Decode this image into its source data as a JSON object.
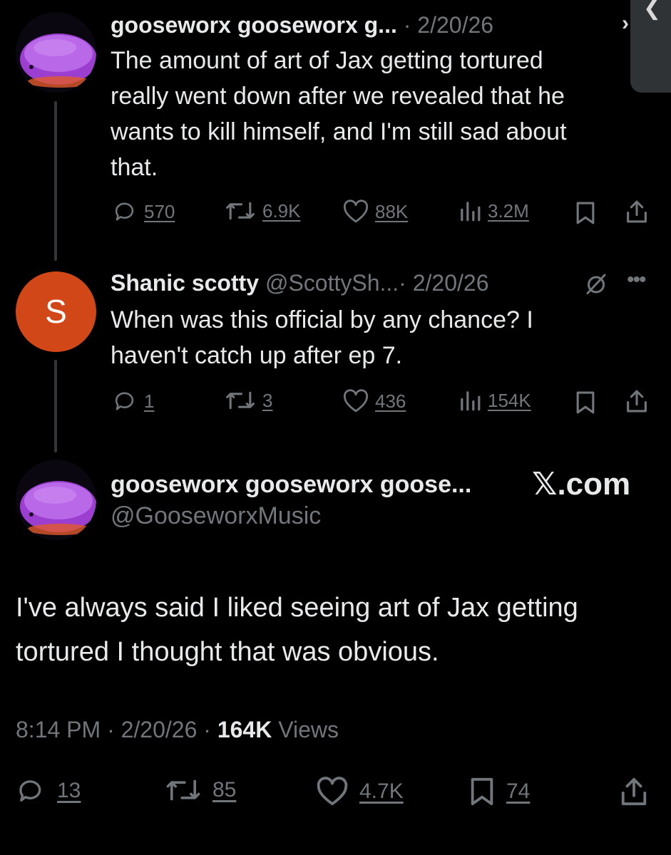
{
  "reply_parent": {
    "display_name": "gooseworx gooseworx g...",
    "separator": "·",
    "date": "2/20/26",
    "lines": [
      "The amount of art of Jax getting tortured",
      "really went down after we revealed that he",
      "wants to kill himself, and I'm still sad about",
      "that."
    ],
    "stats": {
      "replies": "570",
      "reposts": "6.9K",
      "likes": "88K",
      "views": "3.2M"
    }
  },
  "reply": {
    "avatar_letter": "S",
    "display_name": "Shanic scotty",
    "handle": "@ScottySh...",
    "separator": "·",
    "date": "2/20/26",
    "lines": [
      "When was this official by any chance? I",
      "haven't catch up after ep 7."
    ],
    "stats": {
      "replies": "1",
      "reposts": "3",
      "likes": "436",
      "views": "154K"
    }
  },
  "main_tweet": {
    "display_name": "gooseworx gooseworx goose...",
    "handle": "@GooseworxMusic",
    "watermark": "𝕏.com",
    "lines": [
      "I've always said I liked seeing art of Jax getting",
      "tortured I thought that was obvious."
    ],
    "time": "8:14 PM",
    "separator": "·",
    "date": "2/20/26",
    "views_count": "164K",
    "views_label": "Views",
    "stats": {
      "replies": "13",
      "reposts": "85",
      "likes": "4.7K",
      "bookmarks": "74"
    }
  },
  "colors": {
    "background": "#000000",
    "text": "#e7e9ea",
    "muted": "#71767b",
    "avatar_s": "#d14718",
    "avatar_purple": "#a24dd6"
  },
  "icons": [
    "reply-icon",
    "repost-icon",
    "like-icon",
    "views-icon",
    "bookmark-icon",
    "share-icon",
    "mute-icon",
    "more-icon",
    "x-logo-icon"
  ]
}
